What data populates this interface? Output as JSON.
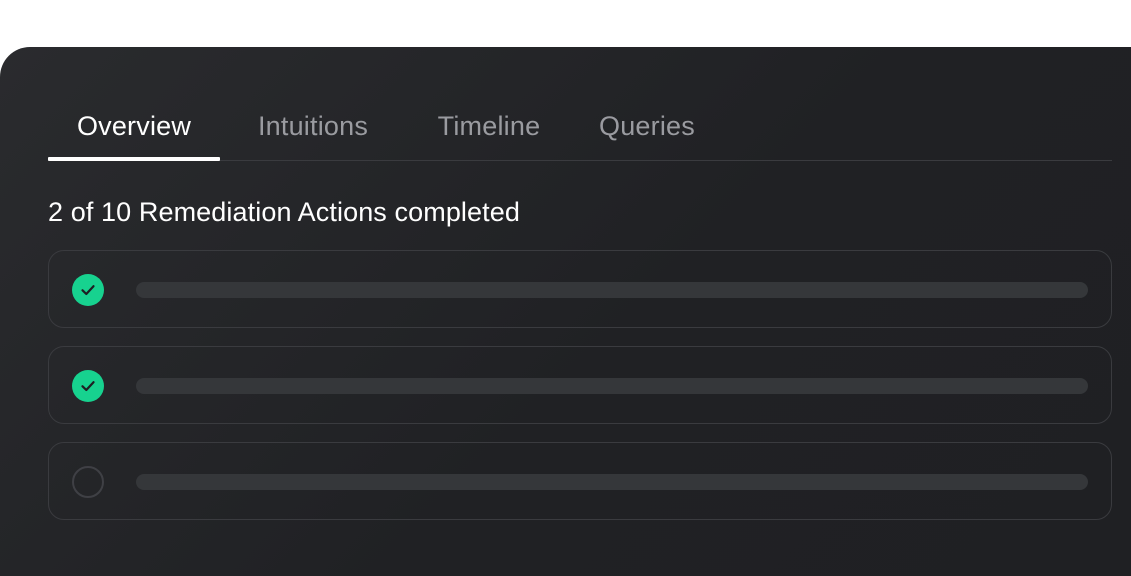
{
  "tabs": [
    {
      "label": "Overview",
      "active": true
    },
    {
      "label": "Intuitions",
      "active": false
    },
    {
      "label": "Timeline",
      "active": false
    },
    {
      "label": "Queries",
      "active": false
    }
  ],
  "summary": {
    "text": "2 of 10 Remediation Actions completed"
  },
  "actions": [
    {
      "status": "completed",
      "icon": "check-circle-icon"
    },
    {
      "status": "completed",
      "icon": "check-circle-icon"
    },
    {
      "status": "pending",
      "icon": "empty-circle-icon"
    }
  ],
  "colors": {
    "panel_background": "#222326",
    "accent_completed": "#17d28f",
    "text_primary": "#ffffff",
    "text_muted": "#9a9ba0",
    "border": "#3a3b3f",
    "skeleton": "#35373a"
  }
}
